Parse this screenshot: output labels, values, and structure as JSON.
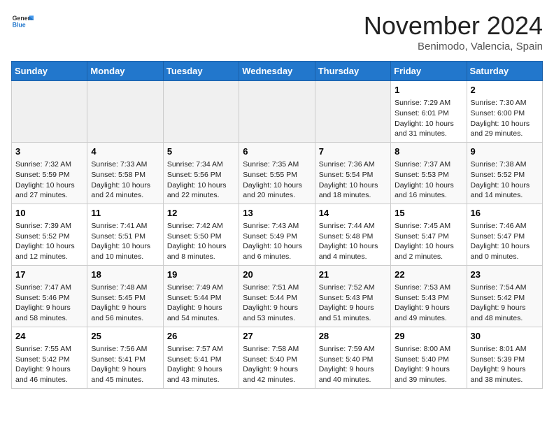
{
  "header": {
    "logo_general": "General",
    "logo_blue": "Blue",
    "month_title": "November 2024",
    "location": "Benimodo, Valencia, Spain"
  },
  "weekdays": [
    "Sunday",
    "Monday",
    "Tuesday",
    "Wednesday",
    "Thursday",
    "Friday",
    "Saturday"
  ],
  "weeks": [
    [
      {
        "day": "",
        "info": ""
      },
      {
        "day": "",
        "info": ""
      },
      {
        "day": "",
        "info": ""
      },
      {
        "day": "",
        "info": ""
      },
      {
        "day": "",
        "info": ""
      },
      {
        "day": "1",
        "info": "Sunrise: 7:29 AM\nSunset: 6:01 PM\nDaylight: 10 hours\nand 31 minutes."
      },
      {
        "day": "2",
        "info": "Sunrise: 7:30 AM\nSunset: 6:00 PM\nDaylight: 10 hours\nand 29 minutes."
      }
    ],
    [
      {
        "day": "3",
        "info": "Sunrise: 7:32 AM\nSunset: 5:59 PM\nDaylight: 10 hours\nand 27 minutes."
      },
      {
        "day": "4",
        "info": "Sunrise: 7:33 AM\nSunset: 5:58 PM\nDaylight: 10 hours\nand 24 minutes."
      },
      {
        "day": "5",
        "info": "Sunrise: 7:34 AM\nSunset: 5:56 PM\nDaylight: 10 hours\nand 22 minutes."
      },
      {
        "day": "6",
        "info": "Sunrise: 7:35 AM\nSunset: 5:55 PM\nDaylight: 10 hours\nand 20 minutes."
      },
      {
        "day": "7",
        "info": "Sunrise: 7:36 AM\nSunset: 5:54 PM\nDaylight: 10 hours\nand 18 minutes."
      },
      {
        "day": "8",
        "info": "Sunrise: 7:37 AM\nSunset: 5:53 PM\nDaylight: 10 hours\nand 16 minutes."
      },
      {
        "day": "9",
        "info": "Sunrise: 7:38 AM\nSunset: 5:52 PM\nDaylight: 10 hours\nand 14 minutes."
      }
    ],
    [
      {
        "day": "10",
        "info": "Sunrise: 7:39 AM\nSunset: 5:52 PM\nDaylight: 10 hours\nand 12 minutes."
      },
      {
        "day": "11",
        "info": "Sunrise: 7:41 AM\nSunset: 5:51 PM\nDaylight: 10 hours\nand 10 minutes."
      },
      {
        "day": "12",
        "info": "Sunrise: 7:42 AM\nSunset: 5:50 PM\nDaylight: 10 hours\nand 8 minutes."
      },
      {
        "day": "13",
        "info": "Sunrise: 7:43 AM\nSunset: 5:49 PM\nDaylight: 10 hours\nand 6 minutes."
      },
      {
        "day": "14",
        "info": "Sunrise: 7:44 AM\nSunset: 5:48 PM\nDaylight: 10 hours\nand 4 minutes."
      },
      {
        "day": "15",
        "info": "Sunrise: 7:45 AM\nSunset: 5:47 PM\nDaylight: 10 hours\nand 2 minutes."
      },
      {
        "day": "16",
        "info": "Sunrise: 7:46 AM\nSunset: 5:47 PM\nDaylight: 10 hours\nand 0 minutes."
      }
    ],
    [
      {
        "day": "17",
        "info": "Sunrise: 7:47 AM\nSunset: 5:46 PM\nDaylight: 9 hours\nand 58 minutes."
      },
      {
        "day": "18",
        "info": "Sunrise: 7:48 AM\nSunset: 5:45 PM\nDaylight: 9 hours\nand 56 minutes."
      },
      {
        "day": "19",
        "info": "Sunrise: 7:49 AM\nSunset: 5:44 PM\nDaylight: 9 hours\nand 54 minutes."
      },
      {
        "day": "20",
        "info": "Sunrise: 7:51 AM\nSunset: 5:44 PM\nDaylight: 9 hours\nand 53 minutes."
      },
      {
        "day": "21",
        "info": "Sunrise: 7:52 AM\nSunset: 5:43 PM\nDaylight: 9 hours\nand 51 minutes."
      },
      {
        "day": "22",
        "info": "Sunrise: 7:53 AM\nSunset: 5:43 PM\nDaylight: 9 hours\nand 49 minutes."
      },
      {
        "day": "23",
        "info": "Sunrise: 7:54 AM\nSunset: 5:42 PM\nDaylight: 9 hours\nand 48 minutes."
      }
    ],
    [
      {
        "day": "24",
        "info": "Sunrise: 7:55 AM\nSunset: 5:42 PM\nDaylight: 9 hours\nand 46 minutes."
      },
      {
        "day": "25",
        "info": "Sunrise: 7:56 AM\nSunset: 5:41 PM\nDaylight: 9 hours\nand 45 minutes."
      },
      {
        "day": "26",
        "info": "Sunrise: 7:57 AM\nSunset: 5:41 PM\nDaylight: 9 hours\nand 43 minutes."
      },
      {
        "day": "27",
        "info": "Sunrise: 7:58 AM\nSunset: 5:40 PM\nDaylight: 9 hours\nand 42 minutes."
      },
      {
        "day": "28",
        "info": "Sunrise: 7:59 AM\nSunset: 5:40 PM\nDaylight: 9 hours\nand 40 minutes."
      },
      {
        "day": "29",
        "info": "Sunrise: 8:00 AM\nSunset: 5:40 PM\nDaylight: 9 hours\nand 39 minutes."
      },
      {
        "day": "30",
        "info": "Sunrise: 8:01 AM\nSunset: 5:39 PM\nDaylight: 9 hours\nand 38 minutes."
      }
    ]
  ]
}
